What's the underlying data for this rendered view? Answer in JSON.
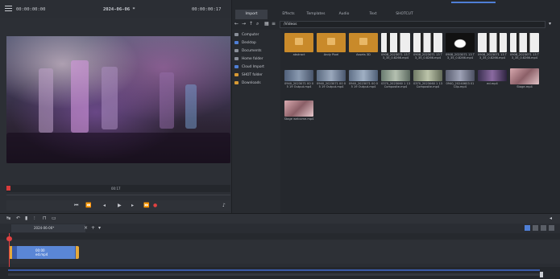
{
  "monitor": {
    "timecode_left": "00:00:00:00",
    "title": "2024-06-06 *",
    "timecode_right": "00:00:00:17",
    "ruler_label": "00:17"
  },
  "library": {
    "tabs": [
      {
        "label": "Import",
        "active": true
      },
      {
        "label": "Effects",
        "active": false
      },
      {
        "label": "Templates",
        "active": false
      },
      {
        "label": "Audio",
        "active": false
      },
      {
        "label": "Text",
        "active": false
      },
      {
        "label": "SHOTCUT",
        "active": false
      }
    ],
    "path": "/Videos",
    "sidebar": [
      {
        "label": "Computer",
        "icon": "computer-icon",
        "color": "#8a8f99"
      },
      {
        "label": "Desktop",
        "icon": "desktop-icon",
        "color": "#4f7fd6"
      },
      {
        "label": "Documents",
        "icon": "documents-icon",
        "color": "#8a8f99"
      },
      {
        "label": "Home folder",
        "icon": "home-icon",
        "color": "#8a8f99"
      },
      {
        "label": "Cloud Import",
        "icon": "cloud-icon",
        "color": "#4f7fd6"
      },
      {
        "label": "SHOT folder",
        "icon": "folder-icon",
        "color": "#d89a34"
      },
      {
        "label": "Downloads",
        "icon": "downloads-icon",
        "color": "#d89a34"
      }
    ],
    "files": [
      {
        "name": "abstract",
        "kind": "folder"
      },
      {
        "name": "Andy Pixel",
        "kind": "folder"
      },
      {
        "name": "Assets 3D",
        "kind": "folder"
      },
      {
        "name": "0908_2023071 13 T3_35_0.8266.mp4",
        "kind": "video",
        "tone": "bw"
      },
      {
        "name": "0908_2023071 13 T3_35_0.8266.mp4",
        "kind": "video",
        "tone": "bw"
      },
      {
        "name": "0908_2023071 13 T3_35_0.8266.mp4",
        "kind": "video",
        "tone": "dark"
      },
      {
        "name": "0908_2023071 13 T3_35_0.8266.mp4",
        "kind": "video",
        "tone": "bw"
      },
      {
        "name": "0908_2023071 13 T3_35_0.8266.mp4",
        "kind": "video",
        "tone": "bw"
      },
      {
        "name": "0940_2023071 00 05 19 Output.mp4",
        "kind": "video",
        "tone": "color"
      },
      {
        "name": "0940_2023071 00 05 19 Output.mp4",
        "kind": "video",
        "tone": "color"
      },
      {
        "name": "0940_2023071 00 05 19 Output.mp4",
        "kind": "video",
        "tone": "color"
      },
      {
        "name": "0370_2023060 1 13 Composite.mp4",
        "kind": "video",
        "tone": "color"
      },
      {
        "name": "0370_2023060 1 13 Composite.mp4",
        "kind": "video",
        "tone": "color"
      },
      {
        "name": "0940_20240603 01 Clip.mp4",
        "kind": "video",
        "tone": "color"
      },
      {
        "name": "ed.mp4",
        "kind": "video",
        "tone": "purple"
      },
      {
        "name": "Stage.mp4",
        "kind": "video",
        "tone": "pink"
      },
      {
        "name": "Stage welcome.mp4",
        "kind": "video",
        "tone": "pink"
      }
    ]
  },
  "timeline": {
    "sequence_tab": "2024-06-06*",
    "clip_label": "00:00",
    "clip_name": "ed.mp4"
  },
  "colors": {
    "accent": "#4f7fd6",
    "folder": "#c98a2a",
    "playhead": "#e24141"
  }
}
